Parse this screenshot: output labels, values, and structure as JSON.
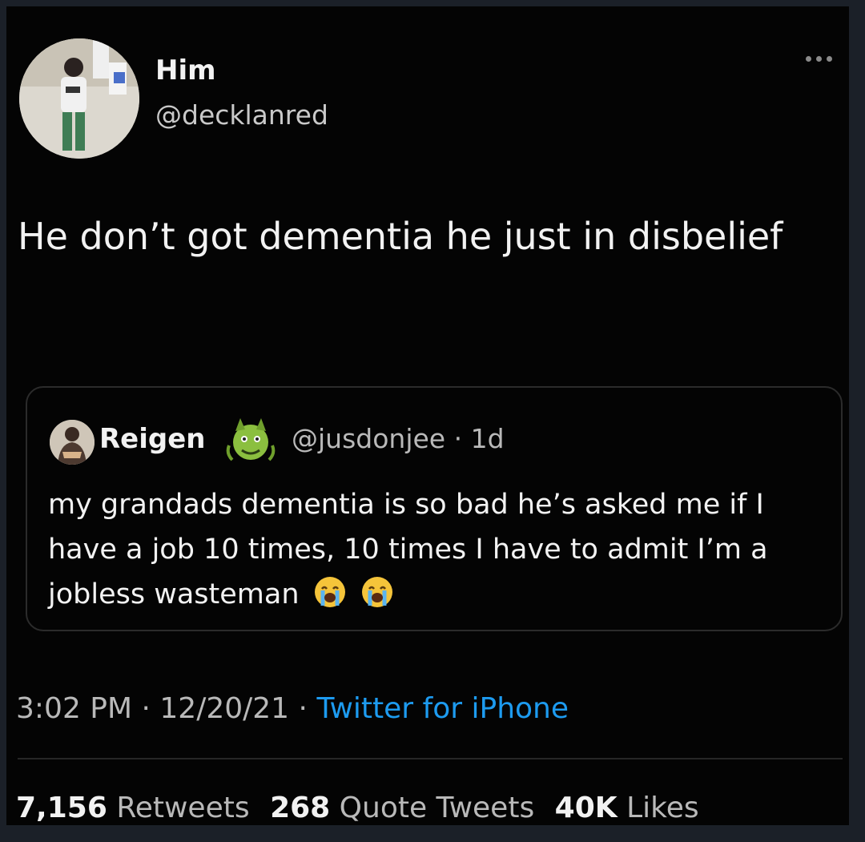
{
  "author": {
    "display_name": "Him",
    "handle": "@decklanred"
  },
  "tweet": {
    "text": "He don’t got dementia he just in disbelief"
  },
  "quoted": {
    "display_name": "Reigen",
    "handle": "@jusdonjee",
    "time_ago": "1d",
    "text": "my grandads dementia is so bad he’s asked me if I have a job 10 times, 10 times I have to admit I’m a jobless wasteman",
    "emojis": [
      "loudly-crying-face",
      "loudly-crying-face"
    ],
    "badge_icon": "dragon-emoji"
  },
  "meta": {
    "time": "3:02 PM",
    "date": "12/20/21",
    "source": "Twitter for iPhone"
  },
  "stats": {
    "retweets_count": "7,156",
    "retweets_label": "Retweets",
    "quotes_count": "268",
    "quotes_label": "Quote Tweets",
    "likes_count": "40K",
    "likes_label": "Likes"
  },
  "colors": {
    "background": "#040404",
    "link": "#1d9bf0",
    "text": "#f2f2f2",
    "muted": "#b9b9b9"
  }
}
